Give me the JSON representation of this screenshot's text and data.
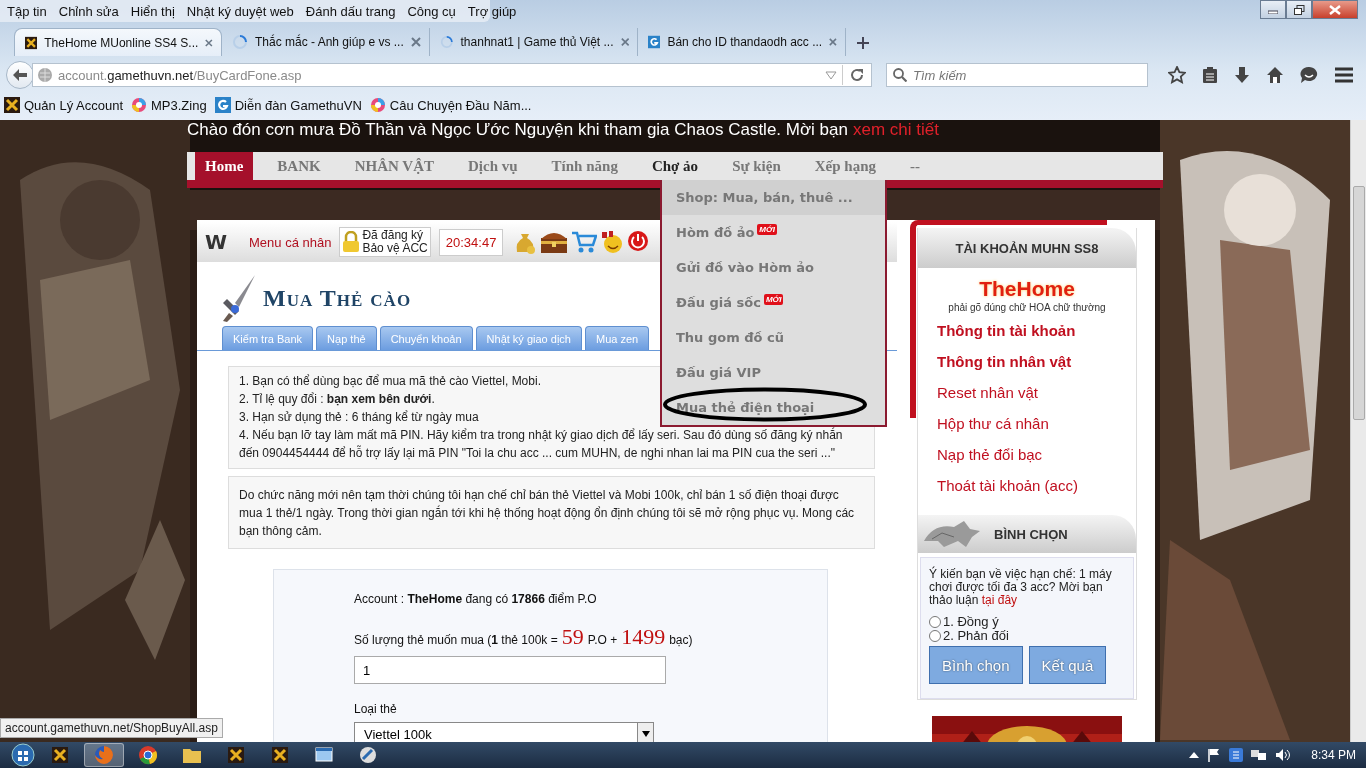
{
  "menu_bar": [
    "Tập tin",
    "Chỉnh sửa",
    "Hiển thị",
    "Nhật ký duyệt web",
    "Đánh dấu trang",
    "Công cụ",
    "Trợ giúp"
  ],
  "tabs": [
    {
      "title": "TheHome MUonline SS4 S...",
      "kind": "site",
      "selected": true
    },
    {
      "title": "Thắc mắc - Anh giúp e vs ...",
      "kind": "loading",
      "selected": false
    },
    {
      "title": "thanhnat1 | Game thủ Việt ...",
      "kind": "loading",
      "selected": false
    },
    {
      "title": "Bán cho ID thandaodh acc ...",
      "kind": "g",
      "selected": false
    }
  ],
  "address_bar": {
    "url_prefix": "account.",
    "url_domain": "gamethuvn.net",
    "url_path": "/BuyCardFone.asp"
  },
  "search": {
    "placeholder": "Tìm kiếm"
  },
  "bookmarks": [
    {
      "label": "Quản Lý Account",
      "kind": "site"
    },
    {
      "label": "MP3.Zing",
      "kind": "globe"
    },
    {
      "label": "Diễn đàn GamethuVN",
      "kind": "g"
    },
    {
      "label": "Câu Chuyện Đầu Năm...",
      "kind": "globe"
    }
  ],
  "page": {
    "banner": {
      "text": "Chào đón cơn mưa Đồ Thần và Ngọc Ước Nguyện khi tham gia Chaos Castle. Mời bạn",
      "link": "xem chi tiết"
    },
    "nav": [
      {
        "label": "Home",
        "selected": true,
        "open": false
      },
      {
        "label": "BANK",
        "selected": false,
        "open": false
      },
      {
        "label": "NHÂN VẬT",
        "selected": false,
        "open": false
      },
      {
        "label": "Dịch vụ",
        "selected": false,
        "open": false
      },
      {
        "label": "Tính năng",
        "selected": false,
        "open": false
      },
      {
        "label": "Chợ ảo",
        "selected": false,
        "open": true,
        "menu": [
          {
            "label": "Shop: Mua, bán, thuê ...",
            "highlighted": true,
            "circled": false
          },
          {
            "label": "Hòm đồ ảo",
            "badge": "MỚI",
            "highlighted": false,
            "circled": false
          },
          {
            "label": "Gửi đồ vào Hòm ảo",
            "highlighted": false,
            "circled": false
          },
          {
            "label": "Đấu giá sốc",
            "badge": "MỚI",
            "highlighted": false,
            "circled": false
          },
          {
            "label": "Thu gom đồ cũ",
            "highlighted": false,
            "circled": false
          },
          {
            "label": "Đấu giá VIP",
            "highlighted": false,
            "circled": false
          },
          {
            "label": "Mua thẻ điện thoại",
            "highlighted": false,
            "circled": true
          }
        ]
      },
      {
        "label": "Sự kiện",
        "selected": false,
        "open": false
      },
      {
        "label": "Xếp hạng",
        "selected": false,
        "open": false
      },
      {
        "label": "--",
        "selected": false,
        "open": false
      }
    ],
    "user_bar": {
      "logo": "W",
      "menu_label": "Menu cá nhân",
      "protect_lines": [
        "Đã đăng ký",
        "Bảo vệ ACC"
      ],
      "clock": "20:34:47"
    },
    "title": "Mua Thẻ cào",
    "sub_tabs": [
      "Kiểm tra Bank",
      "Nạp thẻ",
      "Chuyển khoản",
      "Nhật ký giao dịch",
      "Mua zen"
    ],
    "notes": [
      "1. Bạn có thể dùng bạc để mua mã thẻ cào Viettel, Mobi.",
      "2. Tỉ lệ quy đổi : **bạn xem bên dưới**.",
      "3. Hạn sử dụng thẻ : 6 tháng kể từ ngày mua",
      "4. Nếu bạn lỡ tay làm mất mã PIN. Hãy kiểm tra trong nhật ký giao dịch để lấy seri. Sau đó dùng số đăng ký nhắn đến 0904454444 để hỗ trợ lấy lại mã PIN \"Toi la chu acc ... cum MUHN, de nghi nhan lai ma PIN cua the seri ...\""
    ],
    "notice": "Do chức năng mới nên tạm thời chúng tôi hạn chế chỉ bán thẻ Viettel và Mobi 100k, chỉ bán 1 số điện thoại được mua 1 thẻ/1 ngày. Trong thời gian ngắn tới khi hệ thống hoạt động ổn định chúng tôi sẽ mở rộng phục vụ. Mong các bạn thông cảm.",
    "form": {
      "account_line": "Account : **TheHome** đang có **17866** điểm P.O",
      "quantity_prefix": "Số lượng thẻ muốn mua (**1** thẻ 100k =",
      "po_value": "59",
      "po_unit": "P.O +",
      "silver_value": "1499",
      "silver_unit": "bạc)",
      "quantity_value": "1",
      "card_type_label": "Loại thẻ",
      "card_type_value": "Viettel 100k"
    },
    "account_panel": {
      "title": "TÀI KHOẢN MUHN SS8",
      "username": "TheHome",
      "hint": "phải gõ đúng chữ HOA chữ thường",
      "links": [
        {
          "label": "Thông tin tài khoản",
          "bold": true
        },
        {
          "label": "Thông tin nhân vật",
          "bold": true
        },
        {
          "label": "Reset nhân vật",
          "bold": false
        },
        {
          "label": "Hộp thư cá nhân",
          "bold": false
        },
        {
          "label": "Nạp thẻ đổi bạc",
          "bold": false
        },
        {
          "label": "Thoát tài khoản (acc)",
          "bold": false
        }
      ]
    },
    "poll": {
      "title": "BÌNH CHỌN",
      "question": "Ý kiến bạn về việc hạn chế: 1 máy chơi được tối đa 3 acc? Mời bạn thảo luận",
      "link": "tại đây",
      "options": [
        {
          "label": "1. Đồng ý",
          "selected": false
        },
        {
          "label": "2. Phản đối",
          "selected": false
        }
      ],
      "buttons": [
        "Bình chọn",
        "Kết quả"
      ]
    }
  },
  "status_url": "account.gamethuvn.net/ShopBuyAll.asp",
  "taskbar": {
    "apps": [
      {
        "kind": "game",
        "active": false
      },
      {
        "kind": "firefox",
        "active": true
      },
      {
        "kind": "chrome",
        "active": false
      },
      {
        "kind": "folder",
        "active": false
      },
      {
        "kind": "game",
        "active": false
      },
      {
        "kind": "game",
        "active": false
      },
      {
        "kind": "window",
        "active": false
      },
      {
        "kind": "tool",
        "active": false
      }
    ],
    "clock": "8:34 PM"
  }
}
